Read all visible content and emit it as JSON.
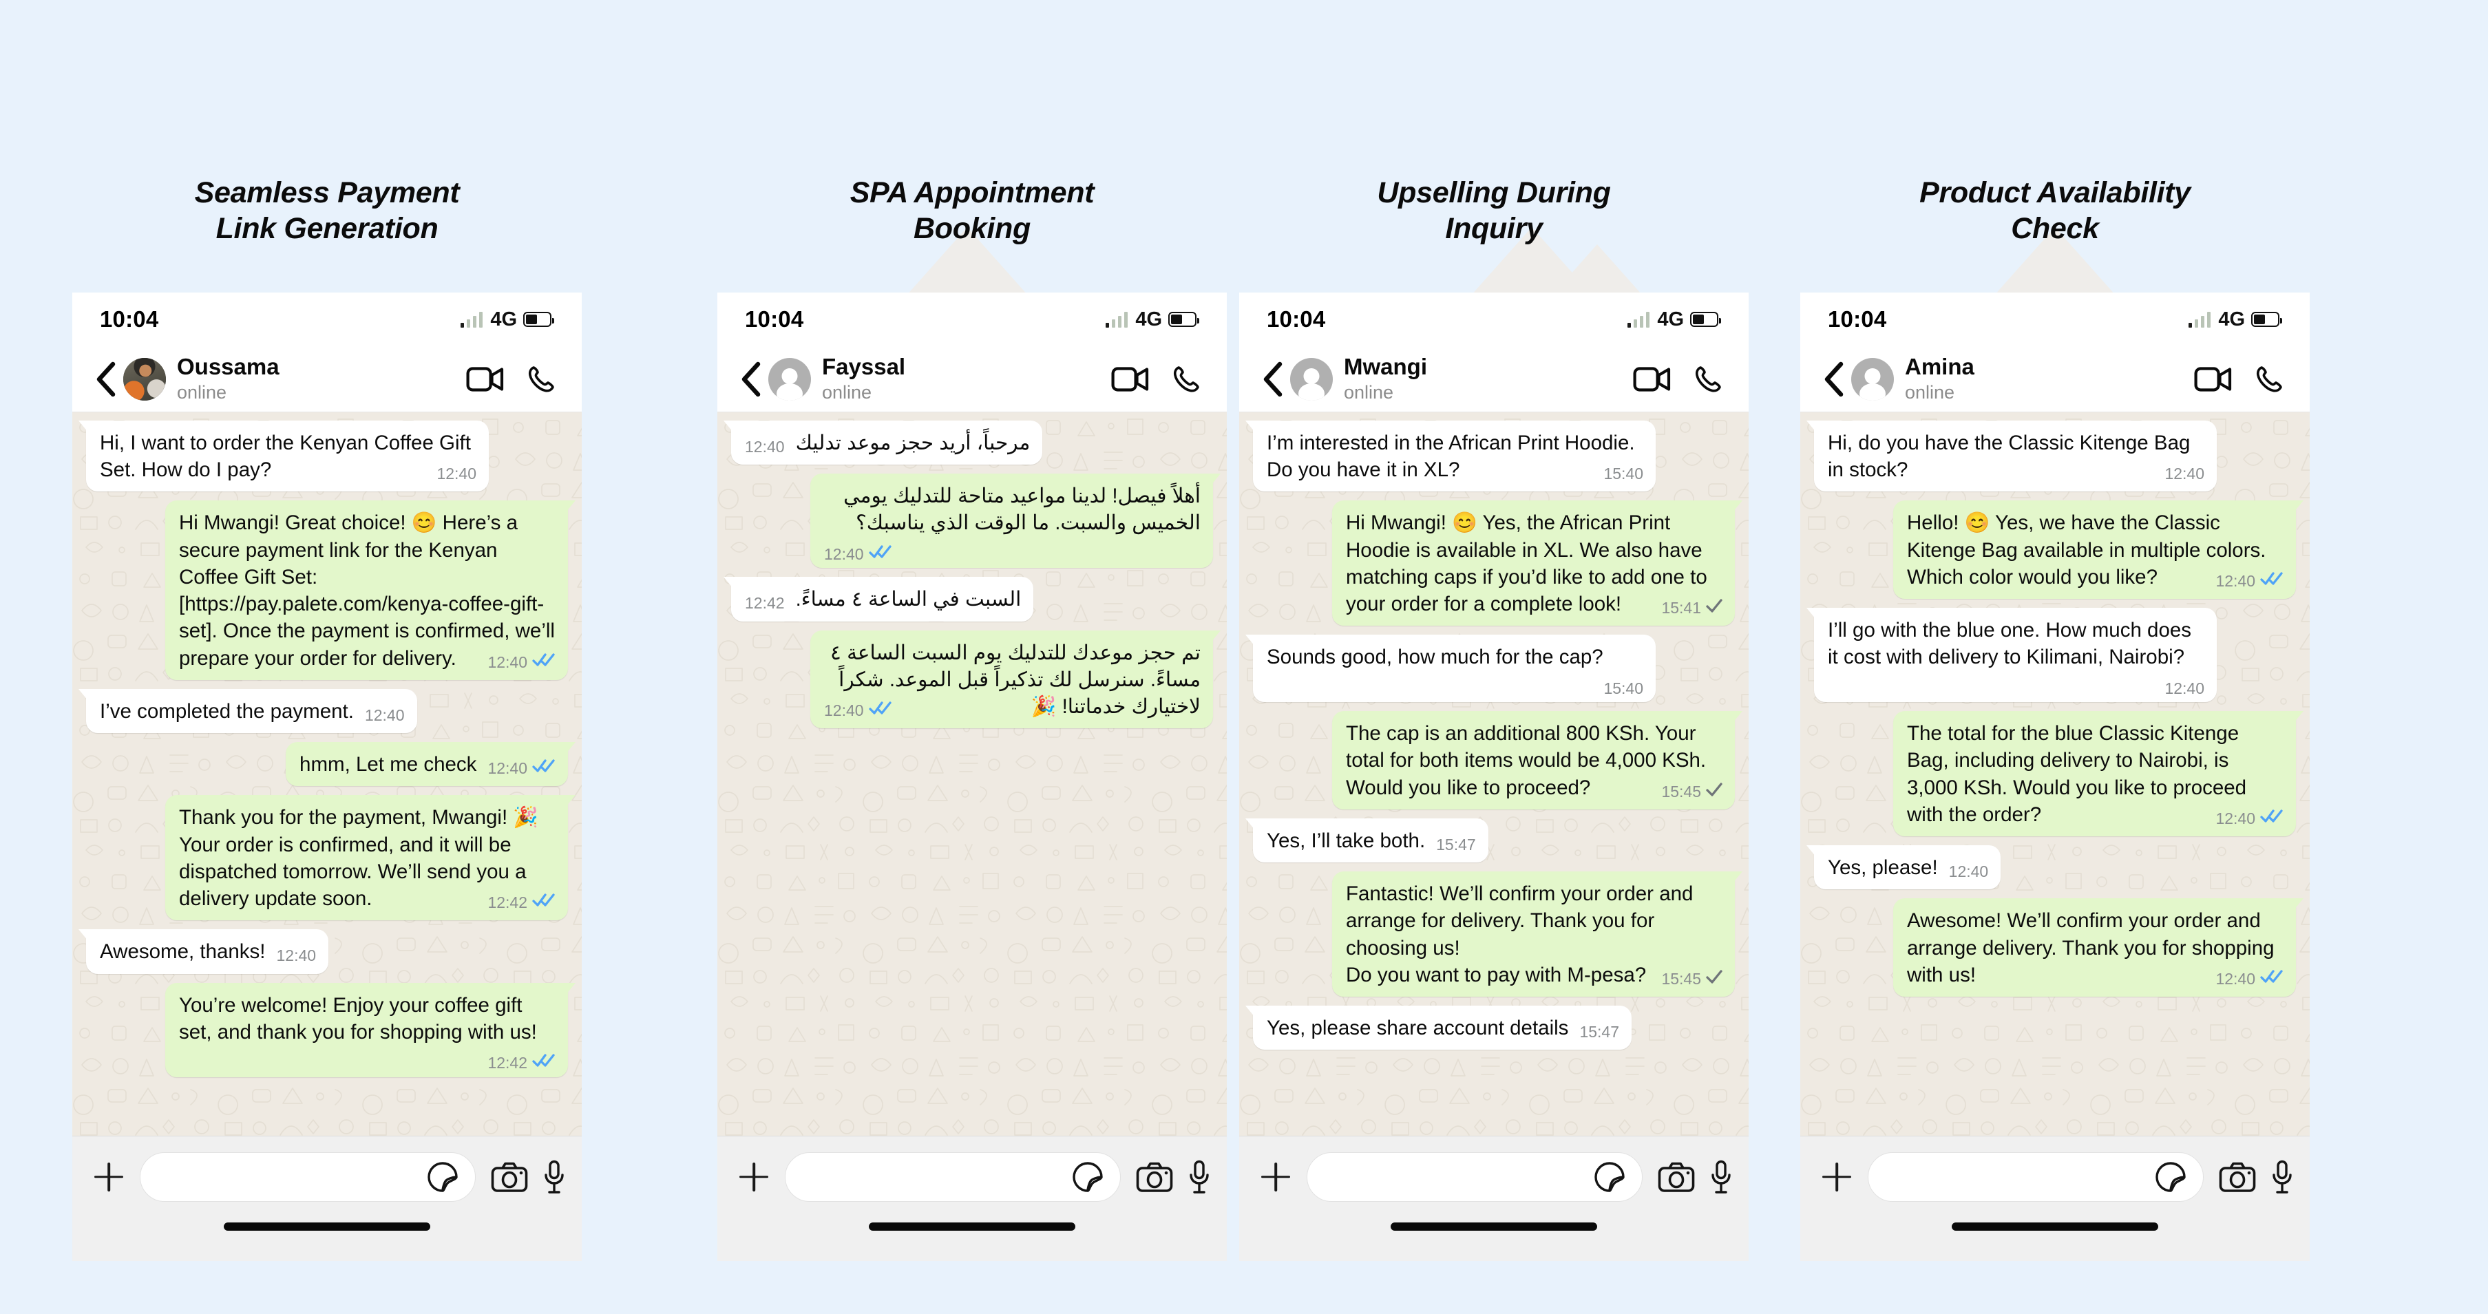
{
  "page": {
    "background_color": "#E8F2FC",
    "accent_bubble_out": "#E3F7CB",
    "accent_bubble_in": "#FFFFFF",
    "chat_wallpaper": "#EFEAE2",
    "tick_read_color": "#4FA3F7",
    "tick_sent_color": "#7E8286"
  },
  "panels": [
    {
      "title_line1": "Seamless Payment",
      "title_line2": "Link Generation",
      "status": {
        "time": "10:04",
        "network": "4G"
      },
      "header": {
        "name": "Oussama",
        "presence": "online",
        "avatar_kind": "photo"
      },
      "messages": [
        {
          "side": "in",
          "text": "Hi, I want to order the Kenyan Coffee Gift Set. How do I pay?",
          "time": "12:40",
          "ticks": "none"
        },
        {
          "side": "out",
          "text": "Hi Mwangi! Great choice! 😊 Here’s a secure payment link for the Kenyan Coffee Gift Set: [https://pay.palete.com/kenya-coffee-gift-set]. Once the payment is confirmed, we’ll prepare your order for delivery.",
          "time": "12:40",
          "ticks": "read"
        },
        {
          "side": "in",
          "text": "I’ve completed the payment.",
          "time": "12:40",
          "ticks": "none"
        },
        {
          "side": "out",
          "text": "hmm, Let me check",
          "time": "12:40",
          "ticks": "read"
        },
        {
          "side": "out",
          "text": "Thank you for the payment, Mwangi! 🎉 Your order is confirmed, and it will be dispatched tomorrow. We’ll send you a delivery update soon.",
          "time": "12:42",
          "ticks": "read"
        },
        {
          "side": "in",
          "text": "Awesome, thanks!",
          "time": "12:40",
          "ticks": "none"
        },
        {
          "side": "out",
          "text": "You’re welcome! Enjoy your coffee gift set, and thank you for shopping with us!",
          "time": "12:42",
          "ticks": "read"
        }
      ]
    },
    {
      "title_line1": "SPA Appointment",
      "title_line2": "Booking",
      "status": {
        "time": "10:04",
        "network": "4G"
      },
      "header": {
        "name": "Fayssal",
        "presence": "online",
        "avatar_kind": "placeholder"
      },
      "messages": [
        {
          "side": "in",
          "rtl": true,
          "text": "مرحباً، أريد حجز موعد تدليك",
          "time": "12:40",
          "ticks": "none"
        },
        {
          "side": "out",
          "rtl": true,
          "text": "أهلاً فيصل! لدينا مواعيد متاحة للتدليك يومي الخميس والسبت. ما الوقت الذي يناسبك؟",
          "time": "12:40",
          "ticks": "read"
        },
        {
          "side": "in",
          "rtl": true,
          "text": "السبت في الساعة ٤ مساءً.",
          "time": "12:42",
          "ticks": "none"
        },
        {
          "side": "out",
          "rtl": true,
          "text": "تم حجز موعدك للتدليك يوم السبت الساعة ٤ مساءً. سنرسل لك تذكيراً قبل الموعد. شكراً لاختيارك خدماتنا! 🎉",
          "time": "12:40",
          "ticks": "read"
        }
      ]
    },
    {
      "title_line1": "Upselling During",
      "title_line2": "Inquiry",
      "status": {
        "time": "10:04",
        "network": "4G"
      },
      "header": {
        "name": "Mwangi",
        "presence": "online",
        "avatar_kind": "placeholder"
      },
      "messages": [
        {
          "side": "in",
          "text": "I’m interested in the African Print Hoodie. Do you have it in XL?",
          "time": "15:40",
          "ticks": "none"
        },
        {
          "side": "out",
          "text": "Hi Mwangi! 😊 Yes, the African Print Hoodie is available in XL. We also have matching caps if you’d like to add one to your order for a complete look!",
          "time": "15:41",
          "ticks": "sent"
        },
        {
          "side": "in",
          "text": "Sounds good, how much for the cap?",
          "time": "15:40",
          "ticks": "none"
        },
        {
          "side": "out",
          "text": "The cap is an additional 800 KSh. Your total for both items would be 4,000 KSh. Would you like to proceed?",
          "time": "15:45",
          "ticks": "sent"
        },
        {
          "side": "in",
          "text": "Yes, I’ll take both.",
          "time": "15:47",
          "ticks": "none"
        },
        {
          "side": "out",
          "text": "Fantastic! We’ll confirm your order and arrange for delivery. Thank you for choosing us!\nDo you want to pay with M-pesa?",
          "time": "15:45",
          "ticks": "sent"
        },
        {
          "side": "in",
          "text": "Yes, please share account details",
          "time": "15:47",
          "ticks": "none"
        }
      ]
    },
    {
      "title_line1": "Product Availability",
      "title_line2": "Check",
      "status": {
        "time": "10:04",
        "network": "4G"
      },
      "header": {
        "name": "Amina",
        "presence": "online",
        "avatar_kind": "placeholder"
      },
      "messages": [
        {
          "side": "in",
          "text": "Hi, do you have the Classic Kitenge Bag in stock?",
          "time": "12:40",
          "ticks": "none"
        },
        {
          "side": "out",
          "text": "Hello! 😊 Yes, we have the Classic Kitenge Bag available in multiple colors. Which color would you like?",
          "time": "12:40",
          "ticks": "read"
        },
        {
          "side": "in",
          "text": "I’ll go with the blue one. How much does it cost with delivery to Kilimani, Nairobi?",
          "time": "12:40",
          "ticks": "none"
        },
        {
          "side": "out",
          "text": "The total for the blue Classic Kitenge Bag, including delivery to Nairobi, is 3,000 KSh. Would you like to proceed with the order?",
          "time": "12:40",
          "ticks": "read"
        },
        {
          "side": "in",
          "text": "Yes, please!",
          "time": "12:40",
          "ticks": "none"
        },
        {
          "side": "out",
          "text": "Awesome! We’ll confirm your order and arrange delivery. Thank you for shopping with us!",
          "time": "12:40",
          "ticks": "read"
        }
      ]
    }
  ],
  "icons": {
    "back": "chevron-left-icon",
    "video": "video-camera-icon",
    "call": "phone-icon",
    "plus": "plus-icon",
    "sticker": "sticker-icon",
    "camera": "camera-icon",
    "mic": "microphone-icon"
  }
}
